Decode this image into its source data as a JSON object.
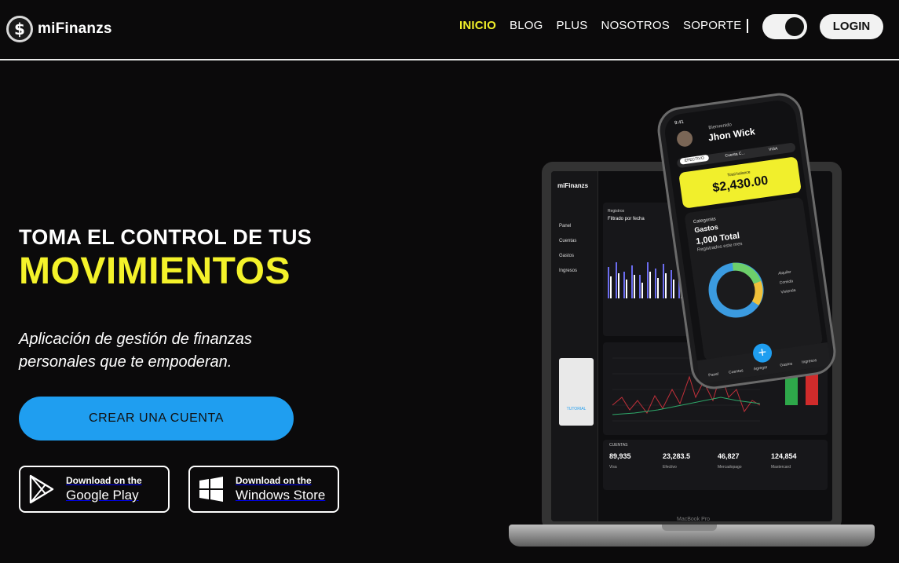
{
  "brand": {
    "logo_symbol": "$",
    "name": "miFinanzs"
  },
  "nav": {
    "items": [
      {
        "label": "INICIO",
        "active": true
      },
      {
        "label": "BLOG",
        "active": false
      },
      {
        "label": "PLUS",
        "active": false
      },
      {
        "label": "NOSOTROS",
        "active": false
      },
      {
        "label": "SOPORTE",
        "active": false
      }
    ],
    "login_label": "LOGIN"
  },
  "hero": {
    "title_line1": "TOMA EL CONTROL DE TUS",
    "title_line2": "MOVIMIENTOS",
    "subtitle": "Aplicación de gestión de finanzas personales que te empoderan.",
    "cta_label": "CREAR UNA CUENTA"
  },
  "stores": {
    "google": {
      "small": "Download on the",
      "big": "Google Play"
    },
    "windows": {
      "small": "Download on the",
      "big": "Windows Store"
    }
  },
  "mockup": {
    "laptop_label": "MacBook Pro",
    "sidebar": [
      "Panel",
      "Cuentas",
      "Gastos",
      "Ingresos"
    ],
    "dashboard_logo": "miFinanzs",
    "registros": "Registros",
    "filtro": "Filtrado por fecha",
    "tutorial": "TUTORIAL",
    "stats": [
      {
        "value": "89,935",
        "label": "Visa"
      },
      {
        "value": "23,283.5",
        "label": "Efectivo"
      },
      {
        "value": "46,827",
        "label": "Mercadopago"
      },
      {
        "value": "124,854",
        "label": "Mastercard"
      }
    ],
    "cuentas_label": "CUENTAS",
    "phone": {
      "time": "9:41",
      "greeting": "Bienvenido",
      "user": "Jhon Wick",
      "tabs": [
        "EFECTIVO",
        "Cuenta C...",
        "VISA"
      ],
      "balance_label": "Total balance",
      "balance_value": "$2,430.00",
      "categorias": "Categorias",
      "gastos": "Gastos",
      "total": "1,000 Total",
      "registrados": "Registrados este mes",
      "legend": [
        "Alquiler",
        "Comida",
        "Vivienda"
      ],
      "bottom_nav": [
        "Panel",
        "Cuentas",
        "Agregar",
        "Gastos",
        "Ingresos"
      ]
    }
  },
  "colors": {
    "accent_yellow": "#f4f22a",
    "accent_blue": "#1f9ef0",
    "background": "#0b0a0b"
  }
}
